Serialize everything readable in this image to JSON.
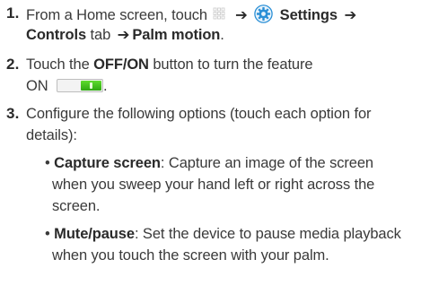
{
  "steps": [
    {
      "number": "1.",
      "text_before_icon": "From a Home screen, touch",
      "arrow": "➔",
      "settings_label": "Settings",
      "controls_label": "Controls",
      "tab_word": "tab",
      "palm_motion_label": "Palm motion",
      "end": ".",
      "icons": [
        "apps-grid-icon",
        "settings-gear-icon"
      ]
    },
    {
      "number": "2.",
      "line1_pre": "Touch the ",
      "off_on_label": "OFF/ON",
      "line1_post": " button to turn the feature",
      "line2": "ON",
      "end": ".",
      "toggle_state": "on",
      "toggle_color": "#3cc21c"
    },
    {
      "number": "3.",
      "line1": "Configure the following options (touch each option for",
      "line2": "details):",
      "bullets": [
        {
          "marker": "•",
          "term": "Capture screen",
          "line1_rest": ": Capture an image of the screen",
          "line2": "when you sweep your hand left or right across the",
          "line3": "screen."
        },
        {
          "marker": "•",
          "term": "Mute/pause",
          "line1_rest": ": Set the device to pause media playback",
          "line2": "when you touch the screen with your palm."
        }
      ]
    }
  ],
  "colors": {
    "text": "#3a3a3a",
    "toggle_on": "#3cc21c",
    "icon_blue": "#2a8fd6"
  }
}
